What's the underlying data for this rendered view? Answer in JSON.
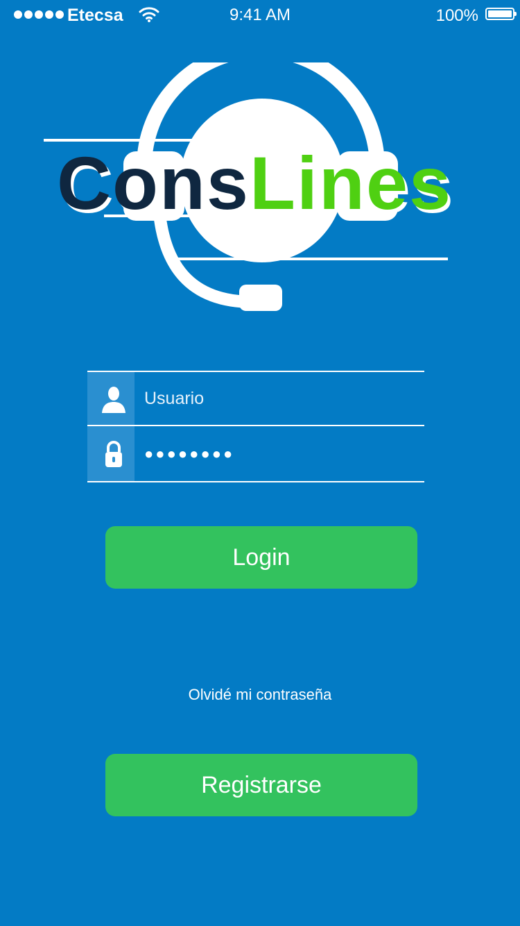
{
  "status_bar": {
    "carrier": "Etecsa",
    "time": "9:41 AM",
    "battery_percent": "100%",
    "icons": [
      "signal-dots-icon",
      "wifi-icon",
      "battery-icon"
    ]
  },
  "logo": {
    "part1": "Cons",
    "part2": "Lines",
    "icon": "headset-icon",
    "colors": {
      "part1": "#0f2740",
      "part2": "#4fd012"
    }
  },
  "form": {
    "username": {
      "value": "Usuario",
      "icon": "user-icon"
    },
    "password": {
      "value": "●●●●●●●●",
      "icon": "lock-icon"
    }
  },
  "buttons": {
    "login": "Login",
    "register": "Registrarse"
  },
  "forgot_password": "Olvidé mi contraseña",
  "colors": {
    "background": "#037bc5",
    "button": "#33c25e",
    "icon_box": "#2a8fd0"
  }
}
